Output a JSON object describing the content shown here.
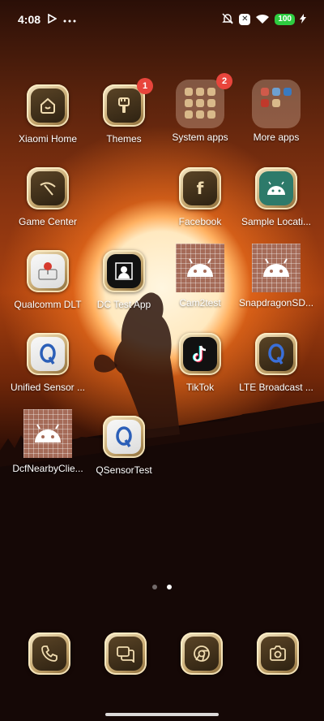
{
  "status": {
    "time": "4:08",
    "battery": "100"
  },
  "apps": [
    {
      "id": "xiaomi-home",
      "label": "Xiaomi Home"
    },
    {
      "id": "themes",
      "label": "Themes",
      "badge": "1"
    },
    {
      "id": "system-apps",
      "label": "System apps",
      "badge": "2"
    },
    {
      "id": "more-apps",
      "label": "More apps"
    },
    {
      "id": "game-center",
      "label": "Game Center"
    },
    {
      "id": "facebook",
      "label": "Facebook"
    },
    {
      "id": "sample-location",
      "label": "Sample Locati..."
    },
    {
      "id": "qualcomm-dlt",
      "label": "Qualcomm DLT"
    },
    {
      "id": "dc-test-app",
      "label": "DC Test App"
    },
    {
      "id": "cam2test",
      "label": "Cam2test"
    },
    {
      "id": "snapdragonsd",
      "label": "SnapdragonSD..."
    },
    {
      "id": "unified-sensor",
      "label": "Unified Sensor ..."
    },
    {
      "id": "tiktok",
      "label": "TikTok"
    },
    {
      "id": "lte-broadcast",
      "label": "LTE Broadcast ..."
    },
    {
      "id": "dcfnearby",
      "label": "DcfNearbyClie..."
    },
    {
      "id": "qsensortest",
      "label": "QSensorTest"
    }
  ],
  "dock": [
    "phone-icon",
    "messages-icon",
    "browser-icon",
    "camera-icon"
  ],
  "pages": {
    "count": 2,
    "active": 2
  }
}
